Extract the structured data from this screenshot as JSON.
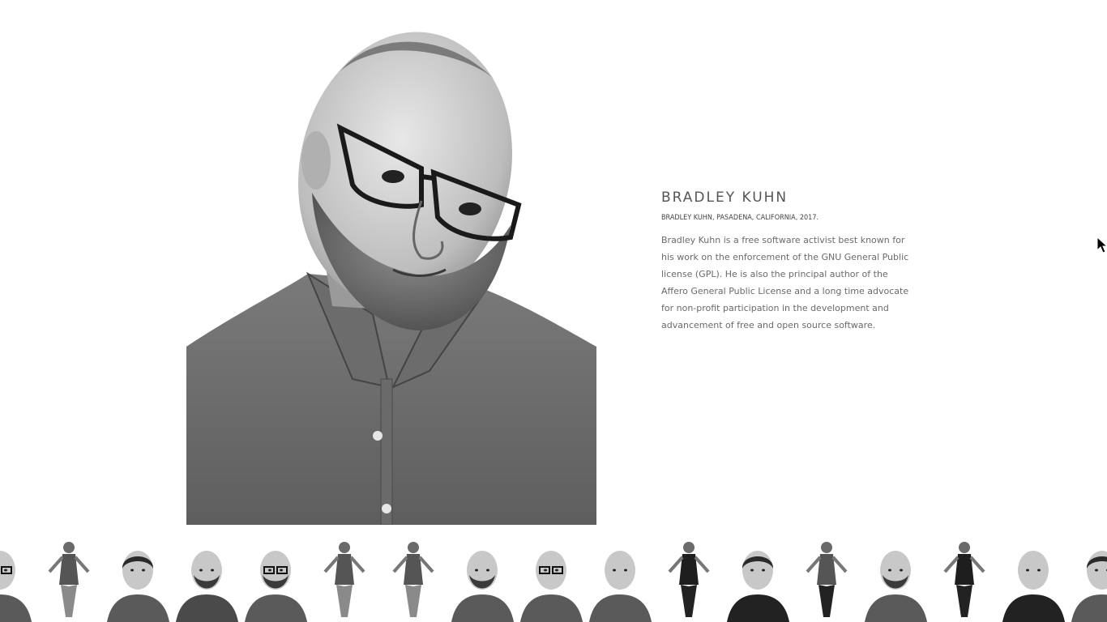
{
  "person": {
    "name": "BRADLEY KUHN",
    "caption": "BRADLEY KUHN, PASADENA, CALIFORNIA, 2017.",
    "bio": "Bradley Kuhn is a free software activist best known for his work on the enforcement of the GNU General Public license (GPL). He is also the principal author of the Affero General Public License and a long time advocate for non-profit participation in the development and advancement of free and open source software."
  },
  "colors": {
    "background": "#ffffff",
    "name_text": "#555555",
    "bio_text": "#6a6a6a"
  },
  "icons": {
    "cursor": "mouse-pointer-icon"
  },
  "thumbnails": [
    {
      "label": "portrait-1",
      "variant": "head-glasses"
    },
    {
      "label": "portrait-2",
      "variant": "full-chair"
    },
    {
      "label": "portrait-3",
      "variant": "head-scarf"
    },
    {
      "label": "portrait-4",
      "variant": "head-beard-hawaiian"
    },
    {
      "label": "portrait-5",
      "variant": "head-glasses-beard"
    },
    {
      "label": "portrait-6",
      "variant": "full-pose"
    },
    {
      "label": "portrait-7",
      "variant": "full-seated"
    },
    {
      "label": "portrait-8",
      "variant": "head-hand"
    },
    {
      "label": "portrait-9",
      "variant": "head-glasses"
    },
    {
      "label": "portrait-10",
      "variant": "head-bald"
    },
    {
      "label": "portrait-11",
      "variant": "full-seated-dark"
    },
    {
      "label": "portrait-12",
      "variant": "head-dark-hair"
    },
    {
      "label": "portrait-13",
      "variant": "full-suit"
    },
    {
      "label": "portrait-14",
      "variant": "head-big-beard"
    },
    {
      "label": "portrait-15",
      "variant": "full-dark-outfit"
    },
    {
      "label": "portrait-16",
      "variant": "head-dark-outfit"
    },
    {
      "label": "portrait-17",
      "variant": "head-partial"
    }
  ]
}
